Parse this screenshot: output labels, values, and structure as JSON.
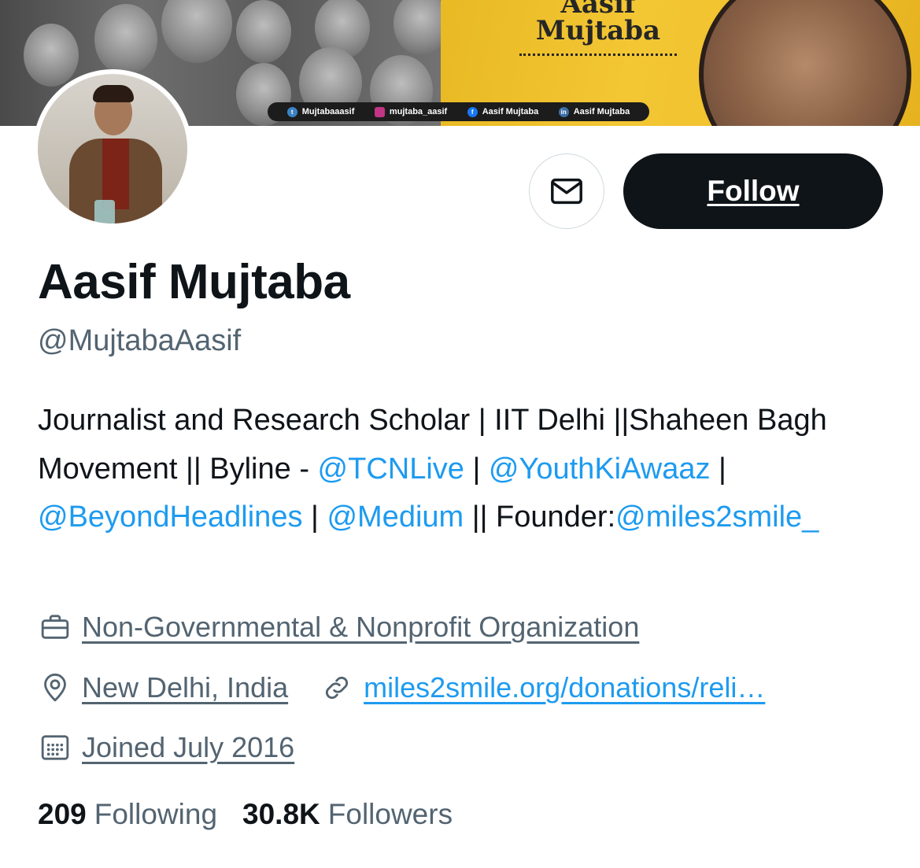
{
  "banner": {
    "name_line1": "Aasif",
    "name_line2": "Mujtaba",
    "socials": [
      {
        "icon": "twitter-icon",
        "label": "Mujtabaaasif"
      },
      {
        "icon": "instagram-icon",
        "label": "mujtaba_aasif"
      },
      {
        "icon": "facebook-icon",
        "label": "Aasif Mujtaba"
      },
      {
        "icon": "linkedin-icon",
        "label": "Aasif Mujtaba"
      }
    ]
  },
  "actions": {
    "message_icon": "mail-icon",
    "follow_label": "Follow"
  },
  "profile": {
    "display_name": "Aasif Mujtaba",
    "handle": "@MujtabaAasif",
    "bio": {
      "t1": "Journalist and Research Scholar | IIT Delhi ||Shaheen Bagh Movement || Byline - ",
      "m1": "@TCNLive",
      "t2": " | ",
      "m2": "@YouthKiAwaaz",
      "t3": " | ",
      "m3": "@BeyondHeadlines",
      "t4": " | ",
      "m4": "@Medium",
      "t5": " || Founder:",
      "m5": "@miles2smile_"
    },
    "category": "Non-Governmental & Nonprofit Organization",
    "location": "New Delhi, India",
    "website": "miles2smile.org/donations/reli…",
    "joined": "Joined July 2016"
  },
  "stats": {
    "following_count": "209",
    "following_label": "Following",
    "followers_count": "30.8K",
    "followers_label": "Followers"
  },
  "colors": {
    "link": "#1d9bf0",
    "secondary_text": "#536471",
    "primary_text": "#0f1419",
    "follow_bg": "#0f1419",
    "banner_yellow": "#f0c12d"
  }
}
